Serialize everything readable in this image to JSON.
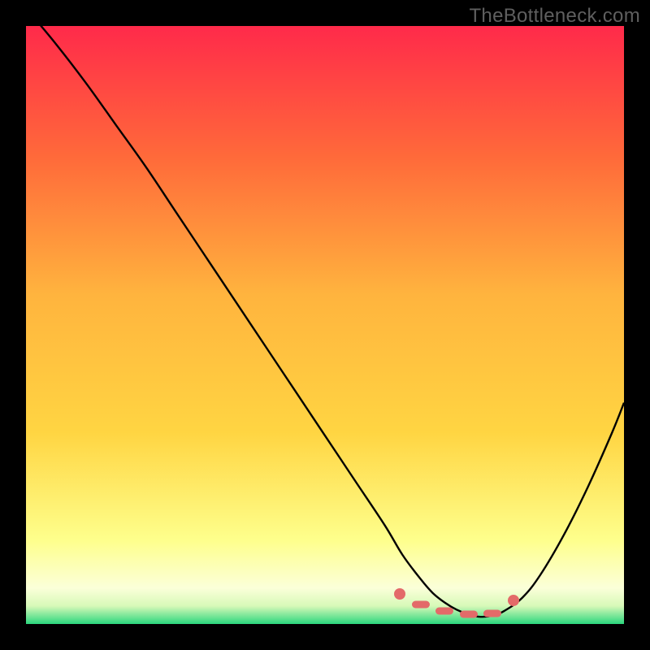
{
  "watermark": "TheBottleneck.com",
  "colors": {
    "gradient_top": "#ff2a4a",
    "gradient_mid1": "#ff7a3a",
    "gradient_mid2": "#ffd542",
    "gradient_mid3": "#fff26a",
    "gradient_mid4": "#ffffd4",
    "gradient_bottom": "#2bd67d",
    "curve": "#000000",
    "marker": "#e36a69",
    "frame_bg": "#000000"
  },
  "chart_data": {
    "type": "line",
    "title": "",
    "xlabel": "",
    "ylabel": "",
    "xlim": [
      0,
      100
    ],
    "ylim": [
      0,
      100
    ],
    "grid": false,
    "series": [
      {
        "name": "bottleneck-curve",
        "x": [
          0,
          5,
          10,
          15,
          20,
          25,
          30,
          35,
          40,
          45,
          50,
          55,
          60,
          63,
          66,
          68,
          70,
          72,
          74,
          76,
          78,
          80,
          83,
          86,
          90,
          94,
          98,
          100
        ],
        "y": [
          103,
          97,
          90.5,
          83.5,
          76.5,
          69,
          61.5,
          54,
          46.5,
          39,
          31.5,
          24,
          16.5,
          11.5,
          7.5,
          5.2,
          3.6,
          2.4,
          1.6,
          1.2,
          1.4,
          2.2,
          4.4,
          8.2,
          15,
          23,
          32,
          37
        ]
      }
    ],
    "markers": [
      {
        "x": 62.5,
        "y": 5.0,
        "shape": "dot"
      },
      {
        "x": 66.0,
        "y": 3.2,
        "shape": "pill",
        "width": 3
      },
      {
        "x": 70.0,
        "y": 2.2,
        "shape": "pill",
        "width": 3
      },
      {
        "x": 74.0,
        "y": 1.6,
        "shape": "pill",
        "width": 3
      },
      {
        "x": 78.0,
        "y": 1.8,
        "shape": "pill",
        "width": 3
      },
      {
        "x": 81.5,
        "y": 4.0,
        "shape": "dot"
      }
    ]
  }
}
